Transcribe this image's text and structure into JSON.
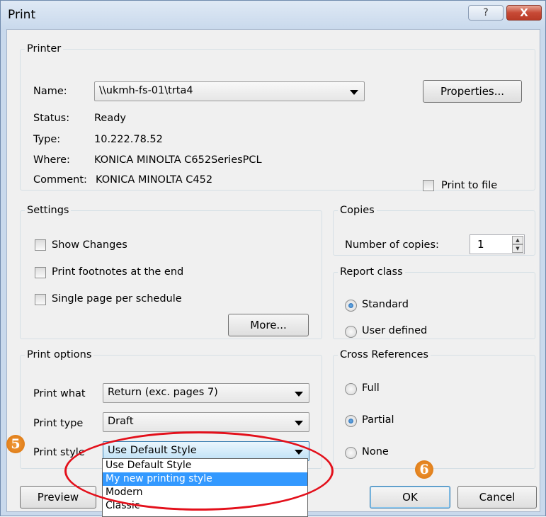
{
  "window": {
    "title": "Print",
    "help_label": "?",
    "close_label": "X"
  },
  "printer": {
    "group_label": "Printer",
    "name_label": "Name:",
    "name_value": "\\\\ukmh-fs-01\\trta4",
    "properties_label": "Properties...",
    "status_label": "Status:",
    "status_value": "Ready",
    "type_label": "Type:",
    "type_value": "10.222.78.52",
    "where_label": "Where:",
    "where_value": "KONICA MINOLTA C652SeriesPCL",
    "comment_label": "Comment:",
    "comment_value": "KONICA MINOLTA C452",
    "print_to_file_label": "Print to file",
    "print_to_file_checked": false
  },
  "settings": {
    "group_label": "Settings",
    "options": [
      {
        "label": "Show Changes",
        "checked": false
      },
      {
        "label": "Print footnotes at the end",
        "checked": false
      },
      {
        "label": "Single page per schedule",
        "checked": false
      }
    ],
    "more_label": "More..."
  },
  "copies": {
    "group_label": "Copies",
    "number_label": "Number of copies:",
    "number_value": "1"
  },
  "report_class": {
    "group_label": "Report class",
    "options": [
      {
        "label": "Standard",
        "selected": true
      },
      {
        "label": "User defined",
        "selected": false
      }
    ]
  },
  "print_options": {
    "group_label": "Print options",
    "what_label": "Print what",
    "what_value": "Return (exc. pages 7)",
    "type_label": "Print type",
    "type_value": "Draft",
    "style_label": "Print style",
    "style_value": "Use Default Style",
    "style_options": [
      "Use Default Style",
      "My new printing style",
      "Modern",
      "Classic"
    ],
    "style_highlighted": "My new printing style"
  },
  "cross_references": {
    "group_label": "Cross References",
    "options": [
      {
        "label": "Full",
        "selected": false
      },
      {
        "label": "Partial",
        "selected": true
      },
      {
        "label": "None",
        "selected": false
      }
    ]
  },
  "buttons": {
    "preview": "Preview",
    "ok": "OK",
    "cancel": "Cancel"
  },
  "annotations": {
    "step5": "5",
    "step6": "6",
    "badge_color": "#e8821c",
    "highlight_color": "#e3101b"
  }
}
